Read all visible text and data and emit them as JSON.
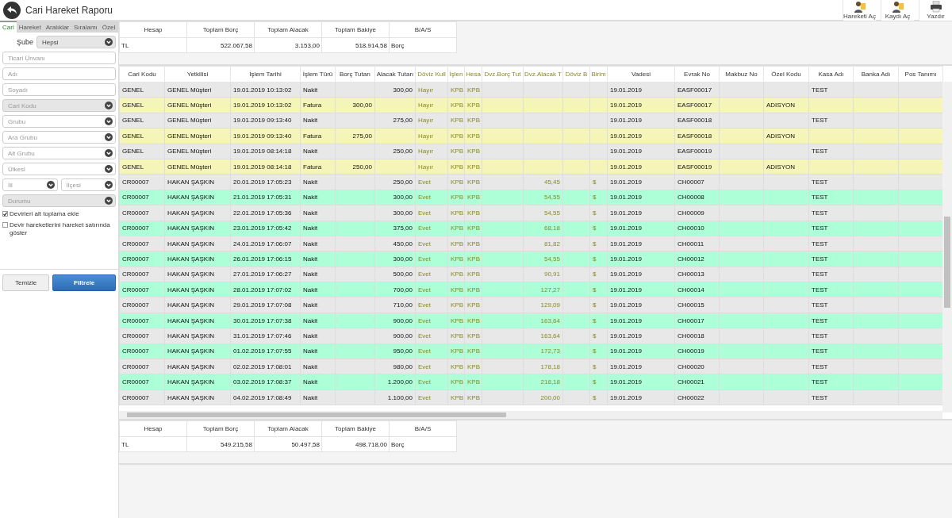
{
  "header": {
    "title": "Cari Hareket Raporu",
    "actions": [
      {
        "label": "Hareketi Aç",
        "kind": "person"
      },
      {
        "label": "Kaydı Aç",
        "kind": "person"
      },
      {
        "label": "Yazdır",
        "kind": "printer"
      }
    ]
  },
  "sidebar": {
    "tabs": [
      {
        "label": "Cari",
        "selected": true
      },
      {
        "label": "Hareket",
        "selected": false
      },
      {
        "label": "Aralıklar",
        "selected": false
      },
      {
        "label": "Sıralamı",
        "selected": false
      },
      {
        "label": "Özel",
        "selected": false
      }
    ],
    "branch": {
      "label": "Şube",
      "value": "Hepsi"
    },
    "fields": [
      {
        "kind": "input",
        "placeholder": "Ticari Ünvanı"
      },
      {
        "kind": "input",
        "placeholder": "Adı"
      },
      {
        "kind": "input",
        "placeholder": "Soyadı"
      },
      {
        "kind": "select",
        "placeholder": "Cari Kodu",
        "disabled": true
      },
      {
        "kind": "select",
        "placeholder": "Grubu",
        "disabled": false
      },
      {
        "kind": "select",
        "placeholder": "Ara Grubu",
        "disabled": false
      },
      {
        "kind": "select",
        "placeholder": "Alt Grubu",
        "disabled": false
      },
      {
        "kind": "select",
        "placeholder": "Ülkesi",
        "disabled": false
      },
      {
        "kind": "pair",
        "items": [
          {
            "placeholder": "İli",
            "disabled": false
          },
          {
            "placeholder": "İlçesi",
            "disabled": false
          }
        ]
      },
      {
        "kind": "select",
        "placeholder": "Durumu",
        "disabled": true
      }
    ],
    "checks": [
      {
        "label": "Devirleri alt toplama ekle",
        "checked": true
      },
      {
        "label": "Devir hareketlerini hareket satırında göster",
        "checked": false
      }
    ],
    "buttons": [
      {
        "label": "Temizle",
        "kind": "secondary"
      },
      {
        "label": "Filtrele",
        "kind": "primary"
      }
    ]
  },
  "summary_top": {
    "columns": [
      "Hesap",
      "Toplam Borç",
      "Toplam Alacak",
      "Toplam Bakiye",
      "B/A/S"
    ],
    "row": [
      "TL",
      "522.067,58",
      "3.153,00",
      "518.914,58",
      "Borç"
    ]
  },
  "table": {
    "columns": [
      {
        "label": "Cari Kodu",
        "kind": "text"
      },
      {
        "label": "Yetkilisi",
        "kind": "text"
      },
      {
        "label": "İşlem Tarihi",
        "kind": "text"
      },
      {
        "label": "İşlem Türü",
        "kind": "text"
      },
      {
        "label": "Borç Tutarı",
        "kind": "amount"
      },
      {
        "label": "Alacak Tutarı",
        "kind": "amount"
      },
      {
        "label": "Döviz Kull",
        "kind": "currency-text"
      },
      {
        "label": "İşlen",
        "kind": "currency-text"
      },
      {
        "label": "Hesa",
        "kind": "currency-text"
      },
      {
        "label": "Dvz.Borç Tut",
        "kind": "currency-amount"
      },
      {
        "label": "Dvz.Alacak T",
        "kind": "currency-amount"
      },
      {
        "label": "Döviz B",
        "kind": "currency-amount"
      },
      {
        "label": "Birim",
        "kind": "currency-text"
      },
      {
        "label": "Vadesi",
        "kind": "text"
      },
      {
        "label": "Evrak No",
        "kind": "text"
      },
      {
        "label": "Makbuz No",
        "kind": "text"
      },
      {
        "label": "Özel Kodu",
        "kind": "text"
      },
      {
        "label": "Kasa Adı",
        "kind": "text"
      },
      {
        "label": "Banka Adı",
        "kind": "text"
      },
      {
        "label": "Pos Tanımı",
        "kind": "text"
      }
    ],
    "rows": [
      {
        "color": "#e8e8e8",
        "cells": [
          "GENEL",
          "GENEL Müşteri",
          "19.01.2019 10:13:02",
          "Nakit",
          "",
          "300,00",
          "Hayır",
          "KPB",
          "KPB",
          "",
          "",
          "",
          "",
          "19.01.2019",
          "EASF00017",
          "",
          "",
          "TEST",
          "",
          ""
        ]
      },
      {
        "color": "#f5f5b8",
        "cells": [
          "GENEL",
          "GENEL Müşteri",
          "19.01.2019 10:13:02",
          "Fatura",
          "300,00",
          "",
          "Hayır",
          "KPB",
          "KPB",
          "",
          "",
          "",
          "",
          "19.01.2019",
          "EASF00017",
          "",
          "ADISYON",
          "",
          "",
          ""
        ]
      },
      {
        "color": "#e8e8e8",
        "cells": [
          "GENEL",
          "GENEL Müşteri",
          "19.01.2019 09:13:40",
          "Nakit",
          "",
          "275,00",
          "Hayır",
          "KPB",
          "KPB",
          "",
          "",
          "",
          "",
          "19.01.2019",
          "EASF00018",
          "",
          "",
          "TEST",
          "",
          ""
        ]
      },
      {
        "color": "#f5f5b8",
        "cells": [
          "GENEL",
          "GENEL Müşteri",
          "19.01.2019 09:13:40",
          "Fatura",
          "275,00",
          "",
          "Hayır",
          "KPB",
          "KPB",
          "",
          "",
          "",
          "",
          "19.01.2019",
          "EASF00018",
          "",
          "ADISYON",
          "",
          "",
          ""
        ]
      },
      {
        "color": "#e8e8e8",
        "cells": [
          "GENEL",
          "GENEL Müşteri",
          "19.01.2019 08:14:18",
          "Nakit",
          "",
          "250,00",
          "Hayır",
          "KPB",
          "KPB",
          "",
          "",
          "",
          "",
          "19.01.2019",
          "EASF00019",
          "",
          "",
          "TEST",
          "",
          ""
        ]
      },
      {
        "color": "#f5f5b8",
        "cells": [
          "GENEL",
          "GENEL Müşteri",
          "19.01.2019 08:14:18",
          "Fatura",
          "250,00",
          "",
          "Hayır",
          "KPB",
          "KPB",
          "",
          "",
          "",
          "",
          "19.01.2019",
          "EASF00019",
          "",
          "ADISYON",
          "",
          "",
          ""
        ]
      },
      {
        "color": "#e8e8e8",
        "cells": [
          "CR00007",
          "HAKAN ŞAŞKIN",
          "20.01.2019 17:05:23",
          "Nakit",
          "",
          "250,00",
          "Evet",
          "KPB",
          "KPB",
          "",
          "45,45",
          "",
          "$",
          "19.01.2019",
          "CH00007",
          "",
          "",
          "TEST",
          "",
          ""
        ]
      },
      {
        "color": "#adffd8",
        "cells": [
          "CR00007",
          "HAKAN ŞAŞKIN",
          "21.01.2019 17:05:31",
          "Nakit",
          "",
          "300,00",
          "Evet",
          "KPB",
          "KPB",
          "",
          "54,55",
          "",
          "$",
          "19.01.2019",
          "CH00008",
          "",
          "",
          "TEST",
          "",
          ""
        ]
      },
      {
        "color": "#e8e8e8",
        "cells": [
          "CR00007",
          "HAKAN ŞAŞKIN",
          "22.01.2019 17:05:36",
          "Nakit",
          "",
          "300,00",
          "Evet",
          "KPB",
          "KPB",
          "",
          "54,55",
          "",
          "$",
          "19.01.2019",
          "CH00009",
          "",
          "",
          "TEST",
          "",
          ""
        ]
      },
      {
        "color": "#adffd8",
        "cells": [
          "CR00007",
          "HAKAN ŞAŞKIN",
          "23.01.2019 17:05:42",
          "Nakit",
          "",
          "375,00",
          "Evet",
          "KPB",
          "KPB",
          "",
          "68,18",
          "",
          "$",
          "19.01.2019",
          "CH00010",
          "",
          "",
          "TEST",
          "",
          ""
        ]
      },
      {
        "color": "#e8e8e8",
        "cells": [
          "CR00007",
          "HAKAN ŞAŞKIN",
          "24.01.2019 17:06:07",
          "Nakit",
          "",
          "450,00",
          "Evet",
          "KPB",
          "KPB",
          "",
          "81,82",
          "",
          "$",
          "19.01.2019",
          "CH00011",
          "",
          "",
          "TEST",
          "",
          ""
        ]
      },
      {
        "color": "#adffd8",
        "cells": [
          "CR00007",
          "HAKAN ŞAŞKIN",
          "26.01.2019 17:06:15",
          "Nakit",
          "",
          "300,00",
          "Evet",
          "KPB",
          "KPB",
          "",
          "54,55",
          "",
          "$",
          "19.01.2019",
          "CH00012",
          "",
          "",
          "TEST",
          "",
          ""
        ]
      },
      {
        "color": "#e8e8e8",
        "cells": [
          "CR00007",
          "HAKAN ŞAŞKIN",
          "27.01.2019 17:06:27",
          "Nakit",
          "",
          "500,00",
          "Evet",
          "KPB",
          "KPB",
          "",
          "90,91",
          "",
          "$",
          "19.01.2019",
          "CH00013",
          "",
          "",
          "TEST",
          "",
          ""
        ]
      },
      {
        "color": "#adffd8",
        "cells": [
          "CR00007",
          "HAKAN ŞAŞKIN",
          "28.01.2019 17:07:02",
          "Nakit",
          "",
          "700,00",
          "Evet",
          "KPB",
          "KPB",
          "",
          "127,27",
          "",
          "$",
          "19.01.2019",
          "CH00014",
          "",
          "",
          "TEST",
          "",
          ""
        ]
      },
      {
        "color": "#e8e8e8",
        "cells": [
          "CR00007",
          "HAKAN ŞAŞKIN",
          "29.01.2019 17:07:08",
          "Nakit",
          "",
          "710,00",
          "Evet",
          "KPB",
          "KPB",
          "",
          "129,09",
          "",
          "$",
          "19.01.2019",
          "CH00015",
          "",
          "",
          "TEST",
          "",
          ""
        ]
      },
      {
        "color": "#adffd8",
        "cells": [
          "CR00007",
          "HAKAN ŞAŞKIN",
          "30.01.2019 17:07:38",
          "Nakit",
          "",
          "900,00",
          "Evet",
          "KPB",
          "KPB",
          "",
          "163,64",
          "",
          "$",
          "19.01.2019",
          "CH00017",
          "",
          "",
          "TEST",
          "",
          ""
        ]
      },
      {
        "color": "#e8e8e8",
        "cells": [
          "CR00007",
          "HAKAN ŞAŞKIN",
          "31.01.2019 17:07:46",
          "Nakit",
          "",
          "900,00",
          "Evet",
          "KPB",
          "KPB",
          "",
          "163,64",
          "",
          "$",
          "19.01.2019",
          "CH00018",
          "",
          "",
          "TEST",
          "",
          ""
        ]
      },
      {
        "color": "#adffd8",
        "cells": [
          "CR00007",
          "HAKAN ŞAŞKIN",
          "01.02.2019 17:07:55",
          "Nakit",
          "",
          "950,00",
          "Evet",
          "KPB",
          "KPB",
          "",
          "172,73",
          "",
          "$",
          "19.01.2019",
          "CH00019",
          "",
          "",
          "TEST",
          "",
          ""
        ]
      },
      {
        "color": "#e8e8e8",
        "cells": [
          "CR00007",
          "HAKAN ŞAŞKIN",
          "02.02.2019 17:08:01",
          "Nakit",
          "",
          "980,00",
          "Evet",
          "KPB",
          "KPB",
          "",
          "178,18",
          "",
          "$",
          "19.01.2019",
          "CH00020",
          "",
          "",
          "TEST",
          "",
          ""
        ]
      },
      {
        "color": "#adffd8",
        "cells": [
          "CR00007",
          "HAKAN ŞAŞKIN",
          "03.02.2019 17:08:37",
          "Nakit",
          "",
          "1.200,00",
          "Evet",
          "KPB",
          "KPB",
          "",
          "218,18",
          "",
          "$",
          "19.01.2019",
          "CH00021",
          "",
          "",
          "TEST",
          "",
          ""
        ]
      },
      {
        "color": "#e8e8e8",
        "cells": [
          "CR00007",
          "HAKAN ŞAŞKIN",
          "04.02.2019 17:08:49",
          "Nakit",
          "",
          "1.100,00",
          "Evet",
          "KPB",
          "KPB",
          "",
          "200,00",
          "",
          "$",
          "19.01.2019",
          "CH00022",
          "",
          "",
          "TEST",
          "",
          ""
        ]
      }
    ]
  },
  "summary_bottom": {
    "columns": [
      "Hesap",
      "Toplam Borç",
      "Toplam Alacak",
      "Toplam Bakiye",
      "B/A/S"
    ],
    "row": [
      "TL",
      "549.215,58",
      "50.497,58",
      "498.718,00",
      "Borç"
    ]
  }
}
